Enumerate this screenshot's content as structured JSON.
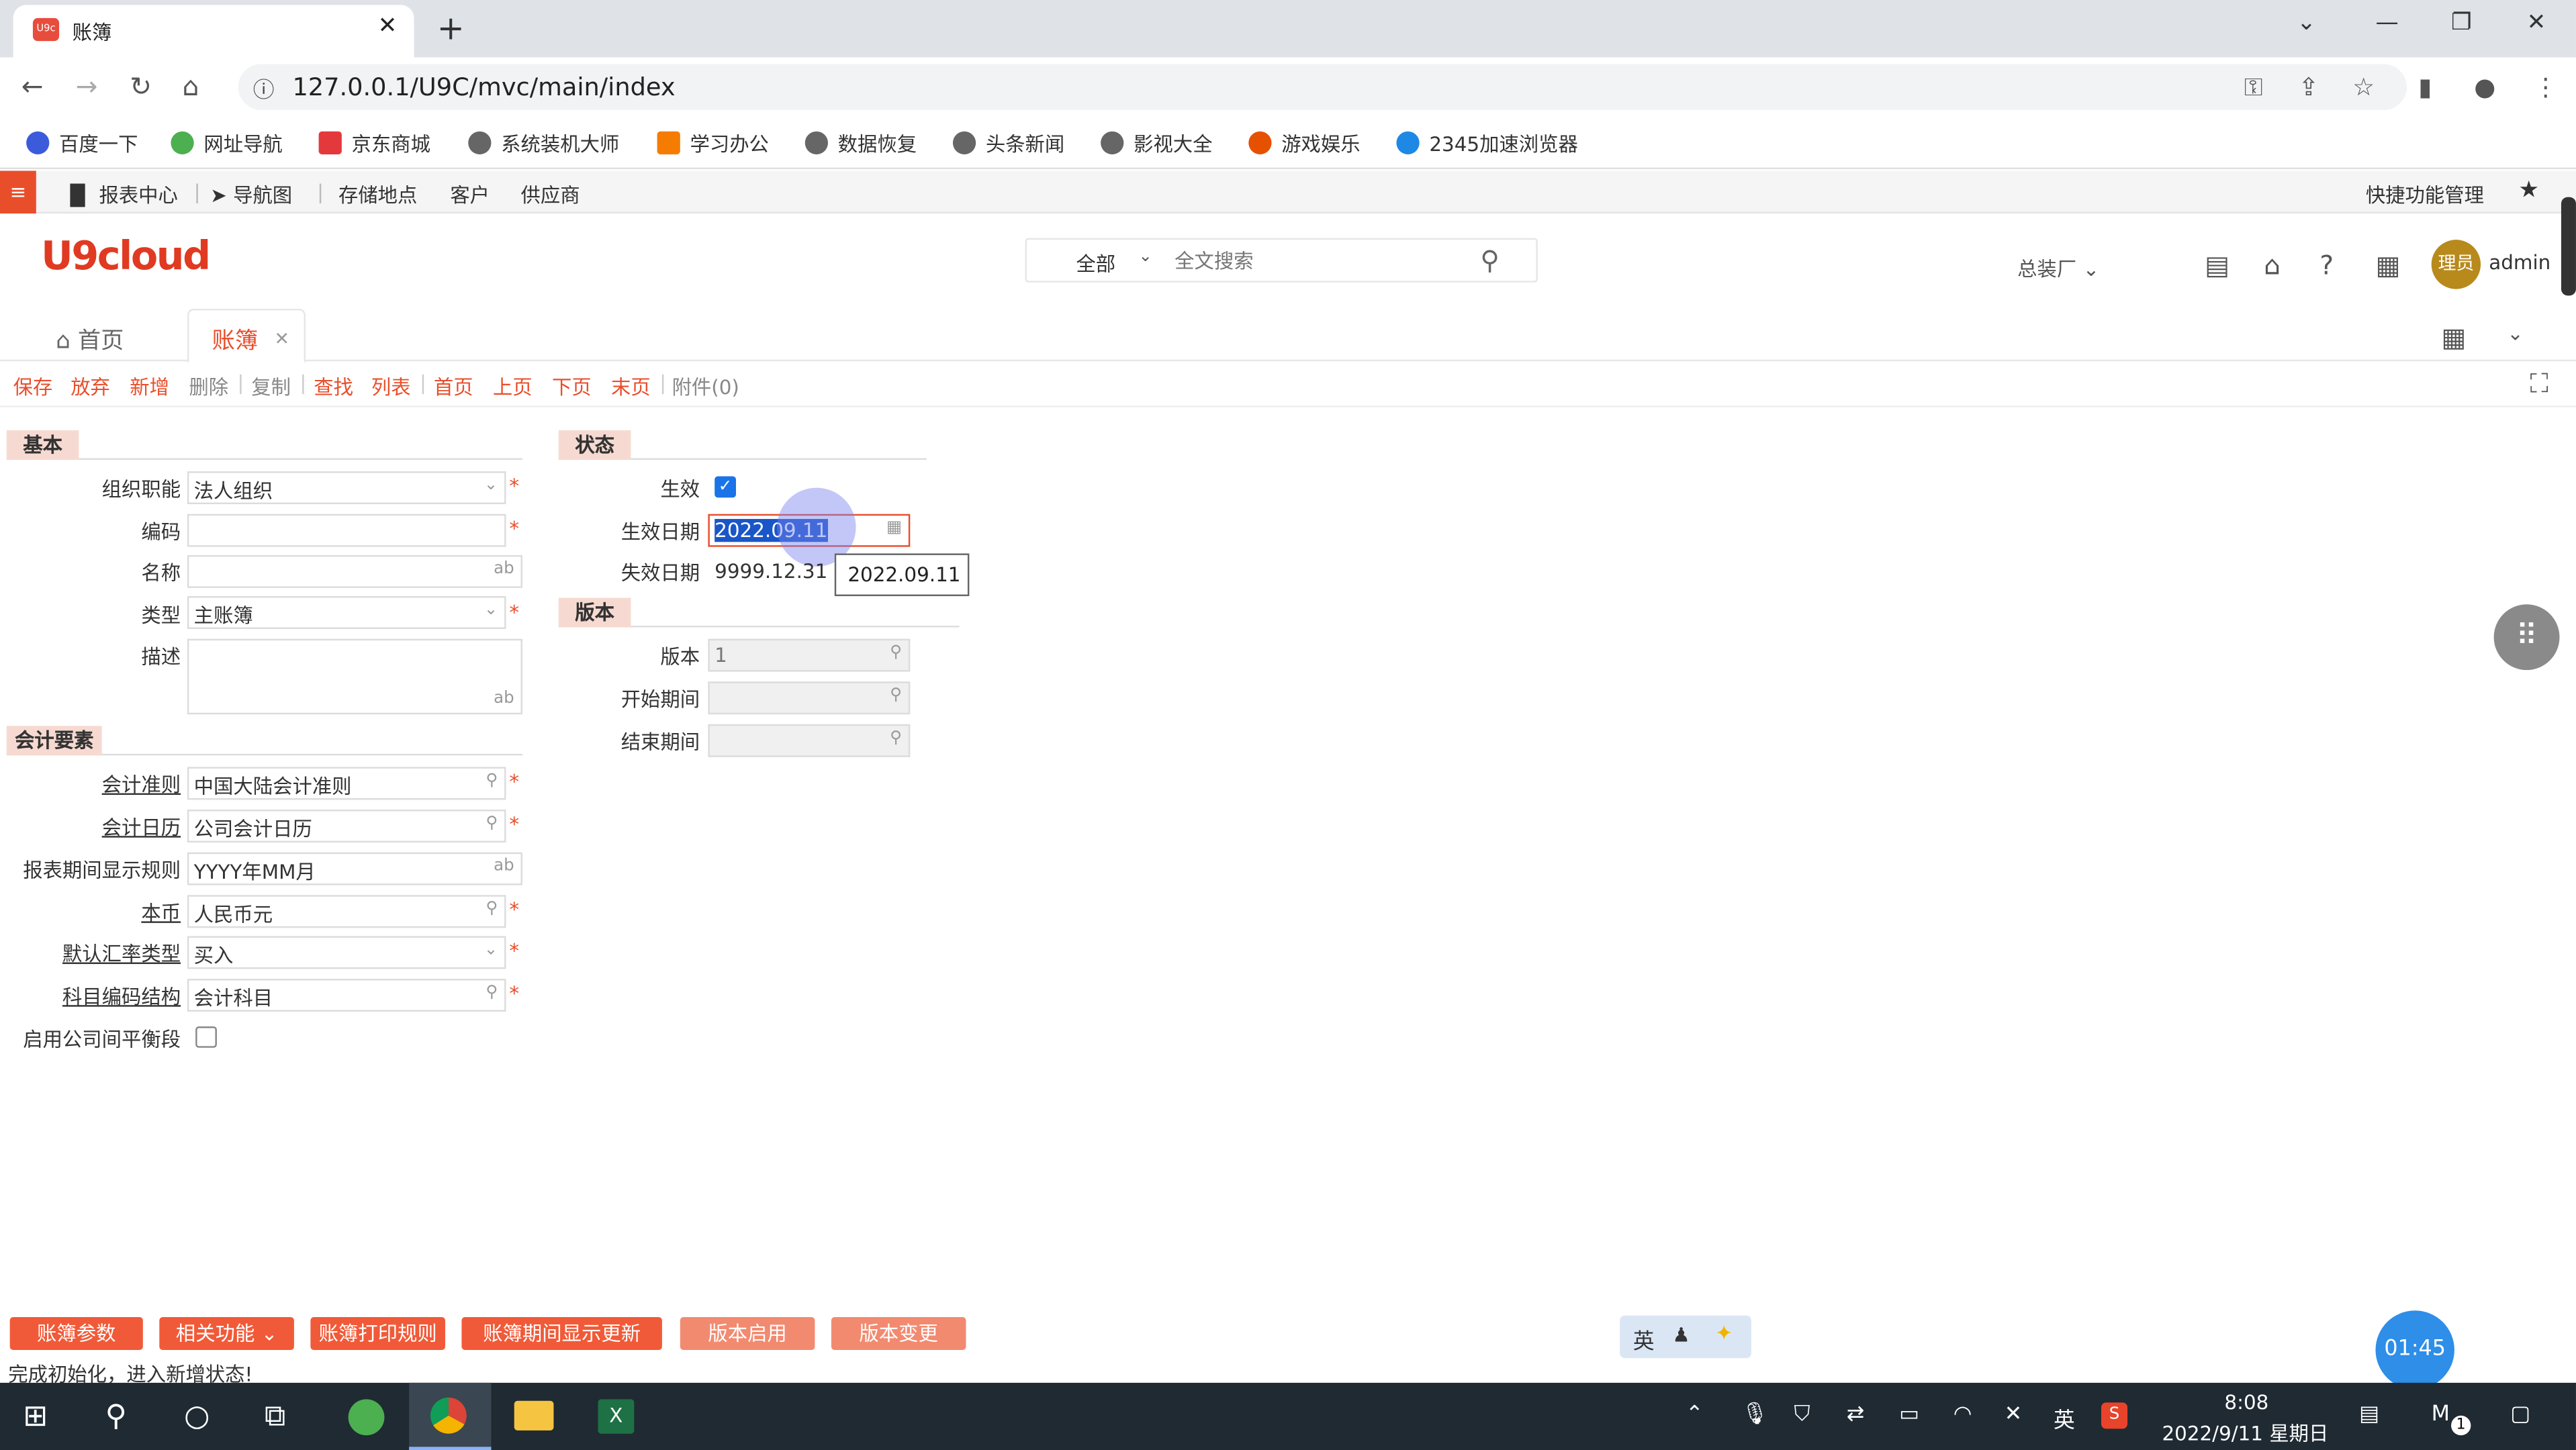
{
  "browser": {
    "tab_title": "账簿",
    "favicon_text": "U9c",
    "url": "127.0.0.1/U9C/mvc/main/index",
    "bookmarks": [
      "百度一下",
      "网址导航",
      "京东商城",
      "系统装机大师",
      "学习办公",
      "数据恢复",
      "头条新闻",
      "影视大全",
      "游戏娱乐",
      "2345加速浏览器"
    ]
  },
  "appbar": {
    "menu_icon": "≡",
    "links": [
      "报表中心",
      "导航图",
      "存储地点",
      "客户",
      "供应商"
    ],
    "quick_func": "快捷功能管理"
  },
  "header": {
    "logo": "U9cloud",
    "search_scope": "全部",
    "search_placeholder": "全文搜索",
    "factory": "总装厂",
    "avatar_text": "理员",
    "user": "admin"
  },
  "page_tabs": {
    "home": "首页",
    "ledger": "账簿"
  },
  "toolbar": [
    "保存",
    "放弃",
    "新增",
    "删除",
    "复制",
    "查找",
    "列表",
    "首页",
    "上页",
    "下页",
    "末页",
    "附件(0)"
  ],
  "form": {
    "basic_title": "基本",
    "org_label": "组织职能",
    "org_value": "法人组织",
    "code_label": "编码",
    "name_label": "名称",
    "type_label": "类型",
    "type_value": "主账簿",
    "desc_label": "描述",
    "accounting_title": "会计要素",
    "standard_label": "会计准则",
    "standard_value": "中国大陆会计准则",
    "calendar_label": "会计日历",
    "calendar_value": "公司会计日历",
    "period_rule_label": "报表期间显示规则",
    "period_rule_value": "YYYY年MM月",
    "currency_label": "本币",
    "currency_value": "人民币元",
    "rate_type_label": "默认汇率类型",
    "rate_type_value": "买入",
    "subject_label": "科目编码结构",
    "subject_value": "会计科目",
    "intercompany_label": "启用公司间平衡段",
    "status_title": "状态",
    "effective_label": "生效",
    "effective_date_label": "生效日期",
    "effective_date_value": "2022.09.11",
    "expire_date_label": "失效日期",
    "expire_date_value": "9999.12.31",
    "tooltip": "2022.09.11",
    "version_title": "版本",
    "version_label": "版本",
    "version_value": "1",
    "start_period_label": "开始期间",
    "end_period_label": "结束期间",
    "ab": "ab"
  },
  "bottom_buttons": [
    "账簿参数",
    "相关功能",
    "账簿打印规则",
    "账簿期间显示更新",
    "版本启用",
    "版本变更"
  ],
  "status_text": "完成初始化，进入新增状态!",
  "ime": {
    "lang": "英"
  },
  "timer": "01:45",
  "taskbar": {
    "ime": "英",
    "time": "8:08",
    "date": "2022/9/11 星期日",
    "notify_count": "1"
  }
}
